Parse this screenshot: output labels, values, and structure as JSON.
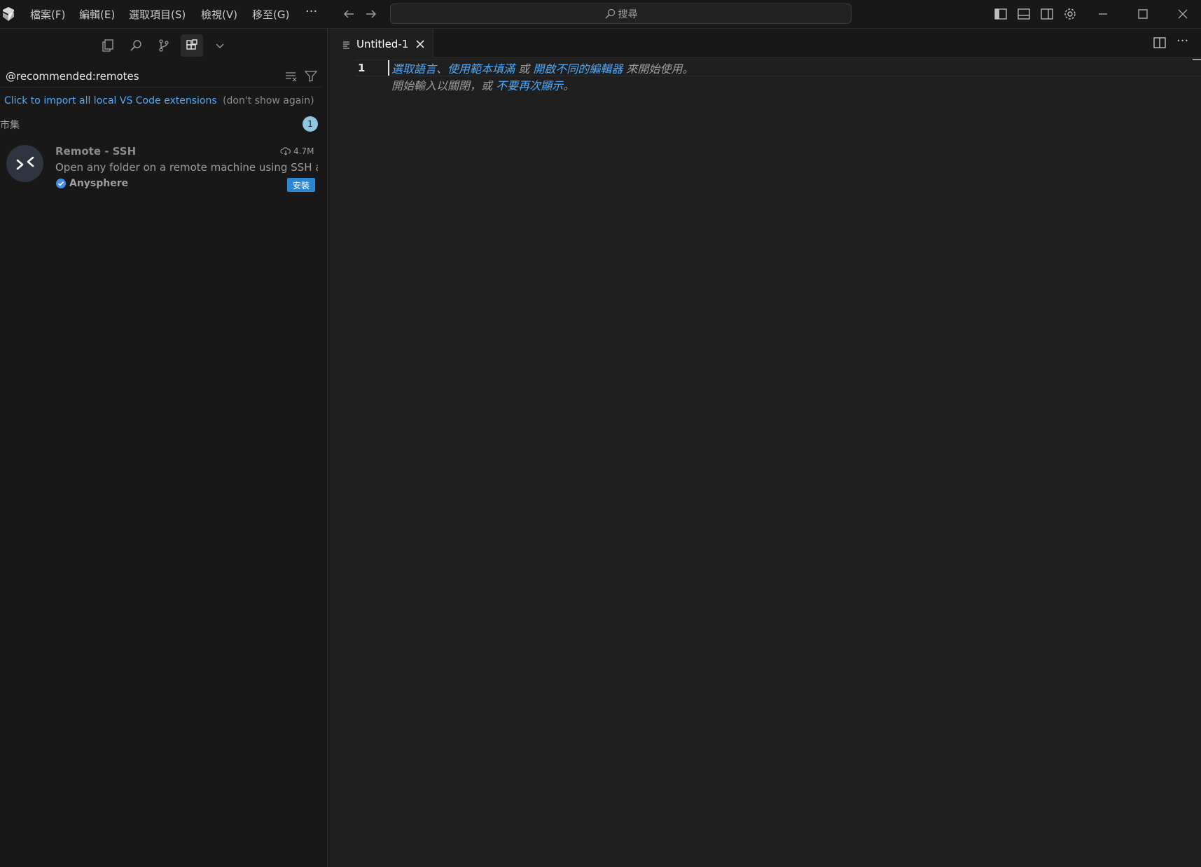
{
  "menu": {
    "items": [
      "檔案(F)",
      "編輯(E)",
      "選取項目(S)",
      "檢視(V)",
      "移至(G)"
    ],
    "more": "···"
  },
  "search": {
    "label": "搜尋"
  },
  "sidebar": {
    "filter_value": "@recommended:remotes",
    "import_link": "Click to import all local VS Code extensions",
    "dont_show": "(don't show again)",
    "section_title": "市集",
    "section_count": "1",
    "extension": {
      "name": "Remote - SSH",
      "downloads": "4.7M",
      "description": "Open any folder on a remote machine using SSH a...",
      "publisher": "Anysphere",
      "install_label": "安裝"
    }
  },
  "editor": {
    "tab_label": "Untitled-1",
    "line_number": "1",
    "hint": {
      "link1": "選取語言",
      "sep1": "、",
      "link2": "使用範本填滿",
      "or1": " 或 ",
      "link3": "開啟不同的編輯器",
      "rest1": " 來開始使用。",
      "line2_prefix": "開始輸入以關閉，或 ",
      "link4": "不要再次顯示",
      "line2_suffix": "。"
    }
  },
  "colors": {
    "background": "#181818",
    "editor_bg": "#1f1f1f",
    "link": "#4daafc",
    "badge": "#2b86d1",
    "count_badge": "#8fc7e0"
  }
}
